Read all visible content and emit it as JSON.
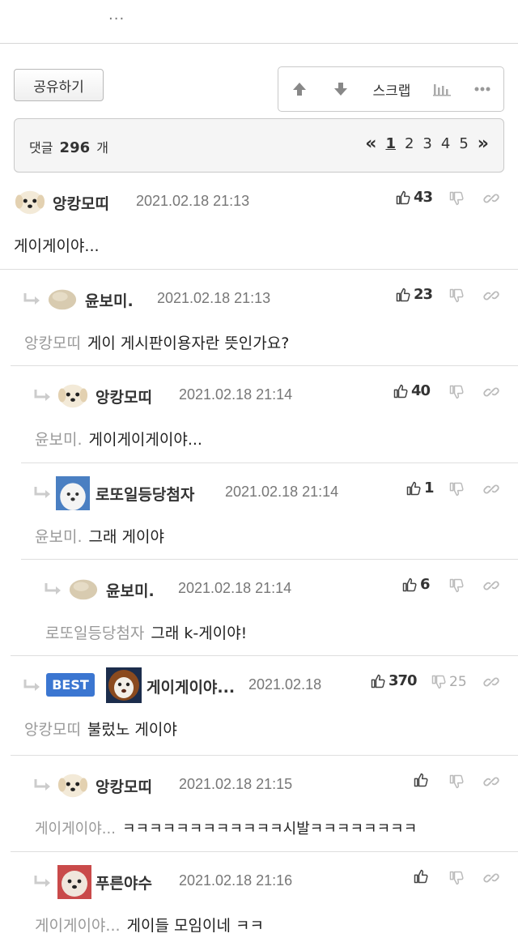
{
  "top": {
    "ellipsis": "..."
  },
  "share_label": "공유하기",
  "toolbar": {
    "scrap_label": "스크랩"
  },
  "comments_header": {
    "prefix": "댓글",
    "count": "296",
    "suffix": "개",
    "pages": [
      "1",
      "2",
      "3",
      "4",
      "5"
    ],
    "prev": "«",
    "next": "»"
  },
  "comments": [
    {
      "nick": "앙캉모띠",
      "date": "2021.02.18 21:13",
      "likes": "43",
      "dislikes": "",
      "reply_to": "",
      "text": "게이게이야..."
    },
    {
      "nick": "윤보미.",
      "date": "2021.02.18 21:13",
      "likes": "23",
      "dislikes": "",
      "reply_to": "앙캉모띠",
      "text": "게이 게시판이용자란 뜻인가요?"
    },
    {
      "nick": "앙캉모띠",
      "date": "2021.02.18 21:14",
      "likes": "40",
      "dislikes": "",
      "reply_to": "윤보미.",
      "text": "게이게이게이야..."
    },
    {
      "nick": "로또일등당첨자",
      "date": "2021.02.18 21:14",
      "likes": "1",
      "dislikes": "",
      "reply_to": "윤보미.",
      "text": "그래 게이야"
    },
    {
      "nick": "윤보미.",
      "date": "2021.02.18 21:14",
      "likes": "6",
      "dislikes": "",
      "reply_to": "로또일등당첨자",
      "text": "그래 k-게이야!"
    },
    {
      "best_label": "BEST",
      "nick": "게이게이야...",
      "date": "2021.02.18",
      "likes": "370",
      "dislikes": "25",
      "reply_to": "앙캉모띠",
      "text": "불렀노 게이야"
    },
    {
      "nick": "앙캉모띠",
      "date": "2021.02.18 21:15",
      "likes": "",
      "dislikes": "",
      "reply_to": "게이게이야...",
      "text": "ㅋㅋㅋㅋㅋㅋㅋㅋㅋㅋㅋㅋ시발ㅋㅋㅋㅋㅋㅋㅋㅋ"
    },
    {
      "nick": "푸른야수",
      "date": "2021.02.18 21:16",
      "likes": "",
      "dislikes": "",
      "reply_to": "게이게이야...",
      "text": "게이들 모임이네 ㅋㅋ"
    }
  ],
  "colors": {
    "best_badge": "#3b76d1",
    "count_bar_bg": "#f5f5f5",
    "muted_text": "#999999"
  },
  "icons": [
    "up-arrow-icon",
    "down-arrow-icon",
    "stats-icon",
    "more-icon",
    "thumbs-up-icon",
    "thumbs-down-icon",
    "link-icon",
    "reply-arrow-icon"
  ]
}
